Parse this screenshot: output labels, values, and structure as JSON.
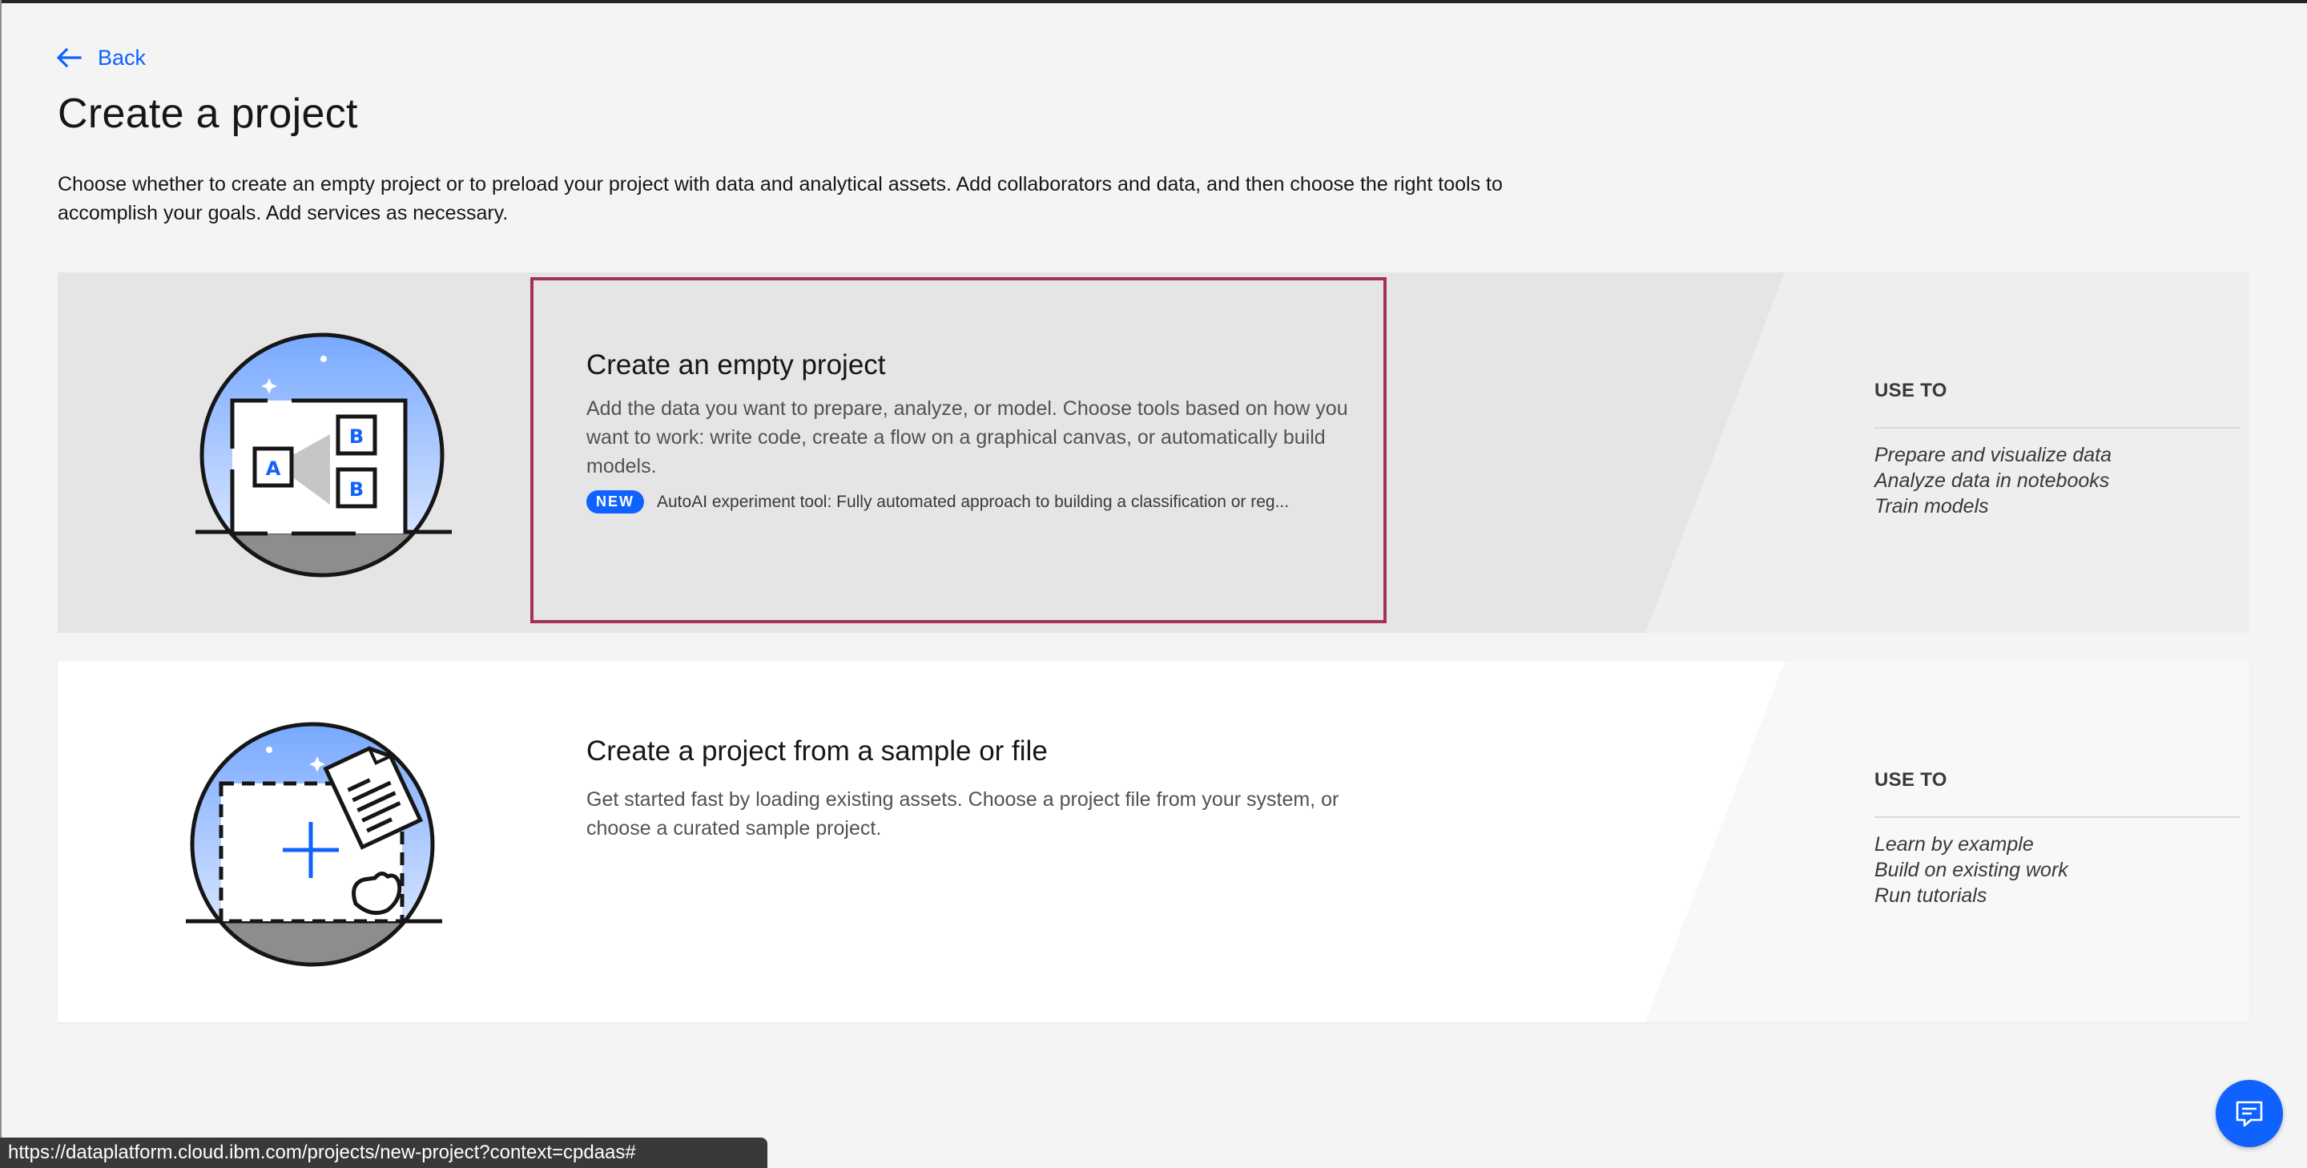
{
  "nav": {
    "back_label": "Back"
  },
  "page": {
    "title": "Create a project",
    "description": "Choose whether to create an empty project or to preload your project with data and analytical assets. Add collaborators and data, and then choose the right tools to accomplish your goals. Add services as necessary."
  },
  "cards": [
    {
      "title": "Create an empty project",
      "description": "Add the data you want to prepare, analyze, or model. Choose tools based on how you want to work: write code, create a flow on a graphical canvas, or automatically build models.",
      "badge": "NEW",
      "badge_text": "AutoAI experiment tool: Fully automated approach to building a classification or reg...",
      "illustration_letters": {
        "a": "A",
        "b": "B"
      },
      "use_to_heading": "USE TO",
      "use_to": [
        "Prepare and visualize data",
        "Analyze data in notebooks",
        "Train models"
      ]
    },
    {
      "title": "Create a project from a sample or file",
      "description": "Get started fast by loading existing assets. Choose a project file from your system, or choose a curated sample project.",
      "use_to_heading": "USE TO",
      "use_to": [
        "Learn by example",
        "Build on existing work",
        "Run tutorials"
      ]
    }
  ],
  "status_bar": {
    "url": "https://dataplatform.cloud.ibm.com/projects/new-project?context=cpdaas#"
  },
  "icons": {
    "back": "arrow-left-icon",
    "chat": "chat-icon",
    "empty_project": "empty-project-illustration",
    "sample_project": "sample-project-illustration"
  },
  "colors": {
    "accent": "#0f62fe",
    "focus_border": "#a6305a",
    "card_selected_bg": "#e5e5e5",
    "card_bg": "#ffffff",
    "page_bg": "#f4f4f4"
  }
}
